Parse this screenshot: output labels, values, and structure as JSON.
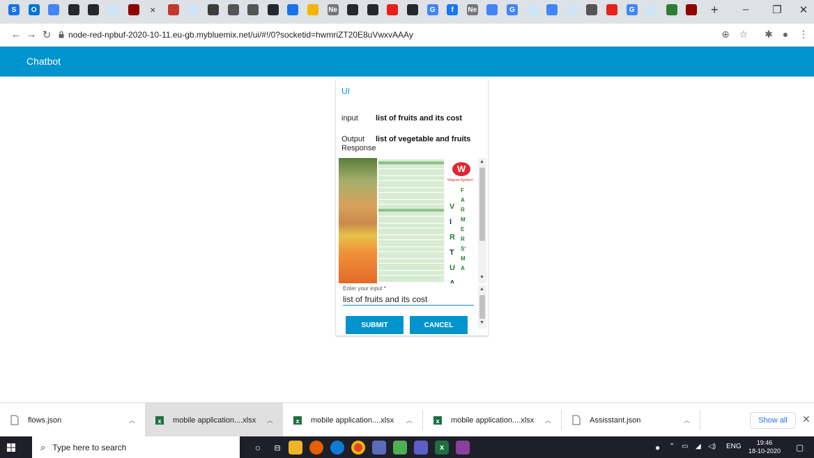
{
  "browser": {
    "url": "node-red-npbuf-2020-10-11.eu-gb.mybluemix.net/ui/#!/0?socketid=hwmriZT20E8uVwxvAAAy",
    "tab_favicons": [
      {
        "name": "s-app-icon",
        "color": "#1a73e8",
        "glyph": "S"
      },
      {
        "name": "outlook-icon",
        "color": "#0078d4",
        "glyph": "O"
      },
      {
        "name": "docs-icon",
        "color": "#4285f4",
        "glyph": ""
      },
      {
        "name": "github-icon",
        "color": "#24292e",
        "glyph": ""
      },
      {
        "name": "github-icon",
        "color": "#24292e",
        "glyph": ""
      },
      {
        "name": "cloud-icon",
        "color": "#cfe4f7",
        "glyph": ""
      },
      {
        "name": "node-red-icon",
        "color": "#8f0000",
        "glyph": ""
      },
      {
        "name": "close-tab-icon",
        "color": "",
        "glyph": "×"
      },
      {
        "name": "node-red-icon",
        "color": "#c0392b",
        "glyph": ""
      },
      {
        "name": "cloud-icon",
        "color": "#cfe4f7",
        "glyph": ""
      },
      {
        "name": "watson-icon",
        "color": "#3d3d3d",
        "glyph": ""
      },
      {
        "name": "ibm-icon",
        "color": "#555",
        "glyph": ""
      },
      {
        "name": "ibm-icon",
        "color": "#555",
        "glyph": ""
      },
      {
        "name": "github-icon",
        "color": "#24292e",
        "glyph": ""
      },
      {
        "name": "doc-icon",
        "color": "#1a73e8",
        "glyph": ""
      },
      {
        "name": "assistant-icon",
        "color": "#f4b400",
        "glyph": ""
      },
      {
        "name": "ne-icon",
        "color": "#777",
        "glyph": "Ne"
      },
      {
        "name": "github-icon",
        "color": "#24292e",
        "glyph": ""
      },
      {
        "name": "github-icon",
        "color": "#24292e",
        "glyph": ""
      },
      {
        "name": "youtube-icon",
        "color": "#e62117",
        "glyph": ""
      },
      {
        "name": "github-icon",
        "color": "#24292e",
        "glyph": ""
      },
      {
        "name": "google-icon",
        "color": "#4285f4",
        "glyph": "G"
      },
      {
        "name": "facebook-icon",
        "color": "#1877f2",
        "glyph": "f"
      },
      {
        "name": "ne-icon",
        "color": "#777",
        "glyph": "Ne"
      },
      {
        "name": "pen-icon",
        "color": "#4285f4",
        "glyph": ""
      },
      {
        "name": "google-icon",
        "color": "#4285f4",
        "glyph": "G"
      },
      {
        "name": "cloud-icon",
        "color": "#cfe4f7",
        "glyph": ""
      },
      {
        "name": "docs-icon",
        "color": "#4285f4",
        "glyph": ""
      },
      {
        "name": "cloud-icon",
        "color": "#cfe4f7",
        "glyph": ""
      },
      {
        "name": "ibm-icon",
        "color": "#555",
        "glyph": ""
      },
      {
        "name": "youtube-icon",
        "color": "#e62117",
        "glyph": ""
      },
      {
        "name": "google-icon",
        "color": "#4285f4",
        "glyph": "G"
      },
      {
        "name": "cloud-icon",
        "color": "#cfe4f7",
        "glyph": ""
      },
      {
        "name": "tape-icon",
        "color": "#2e7d32",
        "glyph": ""
      },
      {
        "name": "node-red-icon",
        "color": "#8f0000",
        "glyph": ""
      }
    ],
    "new_tab_glyph": "+"
  },
  "app": {
    "title": "Chatbot"
  },
  "card": {
    "title": "UI",
    "input_label": "input",
    "input_value": "list of fruits and its cost",
    "output_label": "Output Response",
    "output_value": "list of vegetable and fruits",
    "image": {
      "brand_letter": "W",
      "brand_caption": "Wagran Agritech",
      "column_letters": [
        "V",
        "I",
        "R",
        "T",
        "U",
        "A"
      ],
      "column_letters_2": [
        "F",
        "A",
        "R",
        "M",
        "E",
        "R",
        "S'",
        "M",
        "A"
      ]
    },
    "form": {
      "label": "Enter your input",
      "required_mark": "*",
      "value": "list of fruits and its cost",
      "submit_label": "SUBMIT",
      "cancel_label": "CANCEL"
    }
  },
  "downloads": {
    "items": [
      {
        "name": "flows.json",
        "type": "file"
      },
      {
        "name": "mobile application....xlsx",
        "type": "excel"
      },
      {
        "name": "mobile application....xlsx",
        "type": "excel"
      },
      {
        "name": "mobile application....xlsx",
        "type": "excel"
      },
      {
        "name": "Assisstant.json",
        "type": "file"
      }
    ],
    "show_all_label": "Show all"
  },
  "taskbar": {
    "search_placeholder": "Type here to search",
    "time": "19:46",
    "date": "18-10-2020",
    "lang": "ENG"
  },
  "colors": {
    "accent": "#0094ce",
    "taskbar": "#1f1f2a"
  }
}
